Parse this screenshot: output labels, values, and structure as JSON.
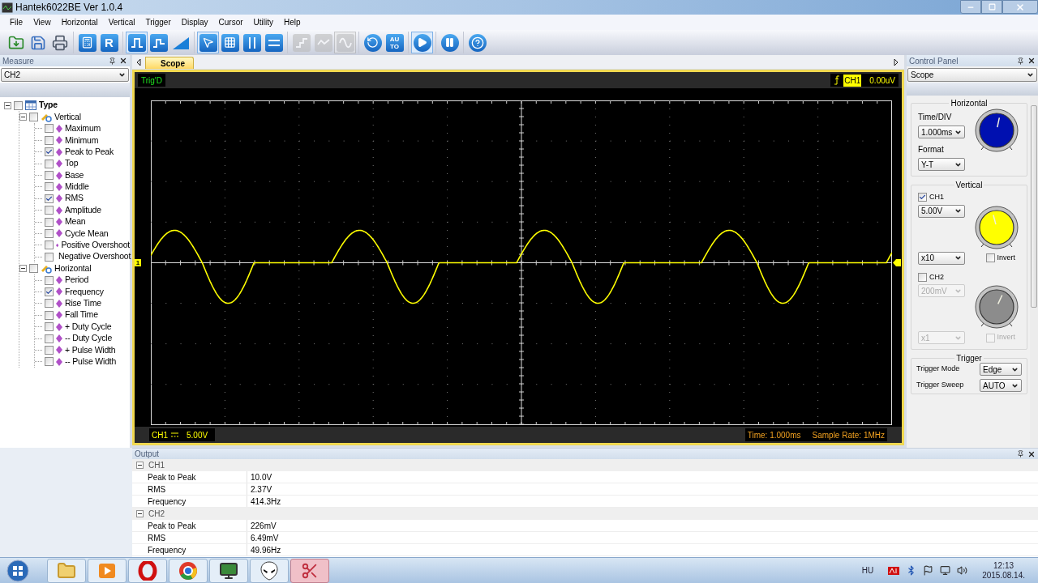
{
  "window": {
    "title": "Hantek6022BE Ver 1.0.4"
  },
  "menu": [
    "File",
    "View",
    "Horizontal",
    "Vertical",
    "Trigger",
    "Display",
    "Cursor",
    "Utility",
    "Help"
  ],
  "toolbar": [
    {
      "buttons": [
        {
          "kind": "open",
          "selected": false,
          "disabled": false
        },
        {
          "kind": "save",
          "selected": false,
          "disabled": false
        },
        {
          "kind": "print",
          "selected": false,
          "disabled": false
        }
      ]
    },
    {
      "buttons": [
        {
          "kind": "math",
          "selected": false,
          "disabled": false
        },
        {
          "kind": "ref",
          "label_lines": [
            "R"
          ],
          "selected": false,
          "disabled": false
        }
      ]
    },
    {
      "buttons": [
        {
          "kind": "pulse",
          "selected": true,
          "disabled": false
        },
        {
          "kind": "pulse2",
          "selected": false,
          "disabled": false
        },
        {
          "kind": "ramp",
          "selected": false,
          "disabled": false
        }
      ]
    },
    {
      "buttons": [
        {
          "kind": "pointer",
          "selected": true,
          "disabled": false
        },
        {
          "kind": "grid",
          "selected": false,
          "disabled": false
        },
        {
          "kind": "vcursor",
          "selected": false,
          "disabled": false
        },
        {
          "kind": "hcursor",
          "selected": false,
          "disabled": false
        }
      ]
    },
    {
      "buttons": [
        {
          "kind": "step",
          "selected": false,
          "disabled": true
        },
        {
          "kind": "wave",
          "selected": false,
          "disabled": true
        },
        {
          "kind": "sine",
          "selected": true,
          "disabled": true
        }
      ]
    },
    {
      "buttons": [
        {
          "kind": "undo",
          "selected": false,
          "disabled": false
        },
        {
          "kind": "auto",
          "label_lines": [
            "AU",
            "TO"
          ],
          "selected": false,
          "disabled": false
        }
      ]
    },
    {
      "buttons": [
        {
          "kind": "run",
          "selected": true,
          "disabled": false
        }
      ]
    },
    {
      "buttons": [
        {
          "kind": "pause",
          "selected": false,
          "disabled": false
        }
      ]
    },
    {
      "buttons": [
        {
          "kind": "help",
          "selected": false,
          "disabled": false
        }
      ]
    }
  ],
  "measure": {
    "title": "Measure",
    "select": "CH2",
    "tree": [
      {
        "label": "Type",
        "kind": "root",
        "checked": false,
        "expanded": true,
        "children": [
          {
            "label": "Vertical",
            "kind": "group",
            "checked": false,
            "expanded": true,
            "children": [
              {
                "label": "Maximum",
                "kind": "item",
                "checked": false
              },
              {
                "label": "Minimum",
                "kind": "item",
                "checked": false
              },
              {
                "label": "Peak to Peak",
                "kind": "item",
                "checked": true
              },
              {
                "label": "Top",
                "kind": "item",
                "checked": false
              },
              {
                "label": "Base",
                "kind": "item",
                "checked": false
              },
              {
                "label": "Middle",
                "kind": "item",
                "checked": false
              },
              {
                "label": "RMS",
                "kind": "item",
                "checked": true
              },
              {
                "label": "Amplitude",
                "kind": "item",
                "checked": false
              },
              {
                "label": "Mean",
                "kind": "item",
                "checked": false
              },
              {
                "label": "Cycle Mean",
                "kind": "item",
                "checked": false
              },
              {
                "label": "Positive Overshoot",
                "kind": "item",
                "checked": false
              },
              {
                "label": "Negative Overshoot",
                "kind": "item",
                "checked": false
              }
            ]
          },
          {
            "label": "Horizontal",
            "kind": "group",
            "checked": false,
            "expanded": true,
            "children": [
              {
                "label": "Period",
                "kind": "item",
                "checked": false
              },
              {
                "label": "Frequency",
                "kind": "item",
                "checked": true
              },
              {
                "label": "Rise Time",
                "kind": "item",
                "checked": false
              },
              {
                "label": "Fall Time",
                "kind": "item",
                "checked": false
              },
              {
                "label": "+ Duty Cycle",
                "kind": "item",
                "checked": false
              },
              {
                "label": "-- Duty Cycle",
                "kind": "item",
                "checked": false
              },
              {
                "label": "+ Pulse Width",
                "kind": "item",
                "checked": false
              },
              {
                "label": "-- Pulse Width",
                "kind": "item",
                "checked": false
              }
            ]
          }
        ]
      }
    ]
  },
  "scope": {
    "tabs": [
      {
        "label": "Scope",
        "selected": true
      }
    ],
    "status": "Trig'D",
    "trigger_channel": "CH1",
    "trigger_level": "0.00uV",
    "marker": "1",
    "channel": "CH1",
    "scale": "5.00V",
    "time": "Time: 1.000ms",
    "sample_rate": "Sample Rate: 1MHz"
  },
  "control_panel": {
    "title": "Control Panel",
    "select": "Scope",
    "horizontal": {
      "title": "Horizontal",
      "time_label": "Time/DIV",
      "time": "1.000ms",
      "format_label": "Format",
      "format": "Y-T"
    },
    "vertical": {
      "title": "Vertical",
      "channels": [
        {
          "name": "CH1",
          "checked": true,
          "volts": "5.00V",
          "probe": "x10",
          "invert_label": "Invert",
          "invert": false,
          "color": "#ffff00"
        },
        {
          "name": "CH2",
          "checked": false,
          "volts": "200mV",
          "probe": "x1",
          "invert_label": "Invert",
          "invert": false,
          "color": "#8c8c8c"
        }
      ]
    },
    "trigger": {
      "title": "Trigger",
      "rows": [
        {
          "label": "Trigger Mode",
          "value": "Edge"
        },
        {
          "label": "Trigger Sweep",
          "value": "AUTO"
        }
      ]
    }
  },
  "output": {
    "title": "Output",
    "groups": [
      {
        "name": "CH1",
        "expanded": true,
        "rows": [
          {
            "label": "Peak to Peak",
            "value": "10.0V"
          },
          {
            "label": "RMS",
            "value": "2.37V"
          },
          {
            "label": "Frequency",
            "value": "414.3Hz"
          }
        ]
      },
      {
        "name": "CH2",
        "expanded": true,
        "rows": [
          {
            "label": "Peak to Peak",
            "value": "226mV"
          },
          {
            "label": "RMS",
            "value": "6.49mV"
          },
          {
            "label": "Frequency",
            "value": "49.96Hz"
          }
        ]
      }
    ]
  },
  "taskbar": {
    "apps": [
      {
        "kind": "folder",
        "selected": false
      },
      {
        "kind": "media",
        "selected": false
      },
      {
        "kind": "opera",
        "selected": false
      },
      {
        "kind": "chrome",
        "selected": false
      },
      {
        "kind": "monitor",
        "selected": false
      },
      {
        "kind": "alien",
        "selected": false
      },
      {
        "kind": "scissors",
        "selected": true
      }
    ],
    "language": "HU",
    "time": "12:13",
    "date": "2015.08.14."
  }
}
